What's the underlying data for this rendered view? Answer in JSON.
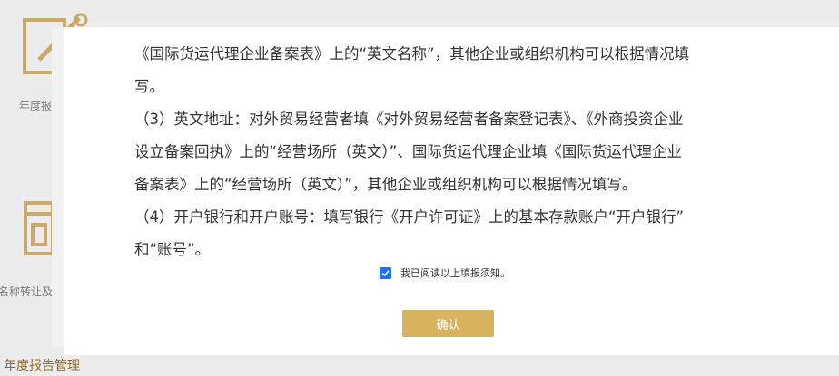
{
  "background": {
    "labels": [
      "年度报",
      "名称转让及"
    ],
    "bottom_title": "年度报告管理"
  },
  "notice": {
    "lines": [
      "《国际货运代理企业备案表》上的“英文名称”，其他企业或组织机构可以根据情况填",
      "写。",
      "（3）英文地址：对外贸易经营者填《对外贸易经营者备案登记表》、《外商投资企业",
      "设立备案回执》上的“经营场所（英文）”、国际货运代理企业填《国际货运代理企业",
      "备案表》上的“经营场所（英文）”，其他企业或组织机构可以根据情况填写。",
      "（4）开户银行和开户账号：填写银行《开户许可证》上的基本存款账户“开户银行”",
      "和“账号”。"
    ]
  },
  "agreement": {
    "checked": true,
    "label": "我已阅读以上填报须知。"
  },
  "confirm_label": "确认",
  "colors": {
    "accent": "#d8b35e",
    "checkbox": "#1a73e8",
    "bg_icon": "#caa96a"
  }
}
